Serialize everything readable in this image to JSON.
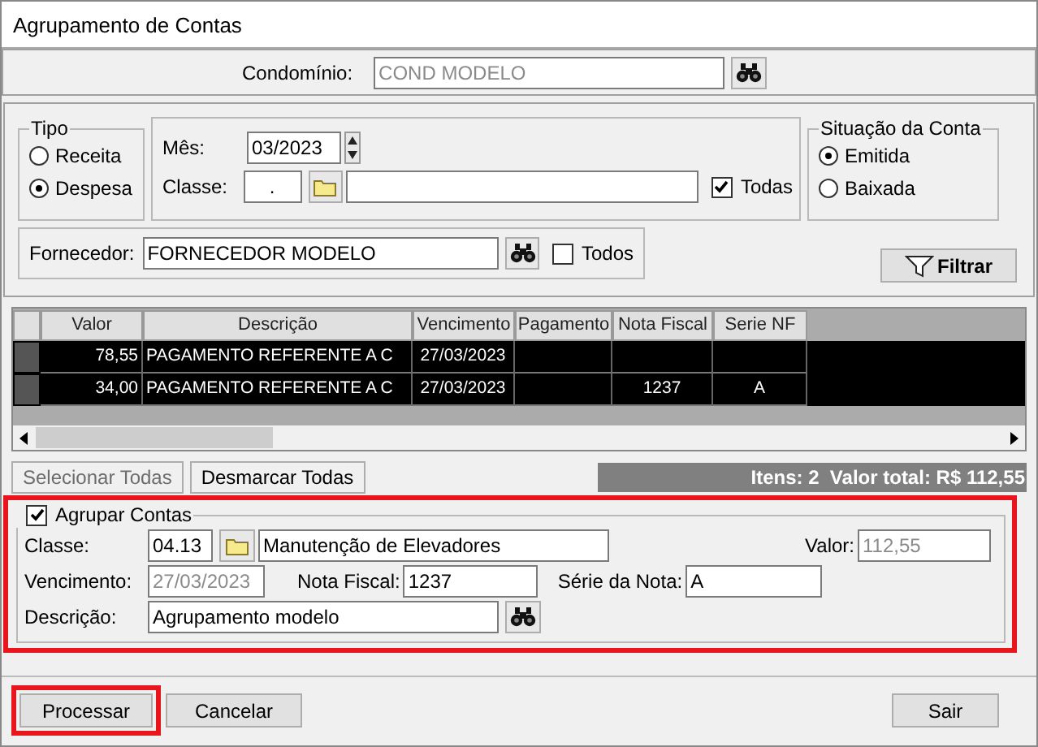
{
  "window": {
    "title": "Agrupamento de Contas"
  },
  "condominio": {
    "label": "Condomínio:",
    "value": "COND MODELO",
    "disabled": true
  },
  "tipo": {
    "title": "Tipo",
    "options": [
      {
        "label": "Receita",
        "selected": false
      },
      {
        "label": "Despesa",
        "selected": true
      }
    ]
  },
  "mes": {
    "label": "Mês:",
    "value": "03/2023"
  },
  "classe_filter": {
    "label": "Classe:",
    "code": ".",
    "todas": {
      "label": "Todas",
      "checked": true
    }
  },
  "situacao": {
    "title": "Situação da Conta",
    "options": [
      {
        "label": "Emitida",
        "selected": true
      },
      {
        "label": "Baixada",
        "selected": false
      }
    ]
  },
  "fornecedor": {
    "label": "Fornecedor:",
    "value": "FORNECEDOR MODELO",
    "todos": {
      "label": "Todos",
      "checked": false
    }
  },
  "filter_button": {
    "label": "Filtrar"
  },
  "table": {
    "columns": [
      "Valor",
      "Descrição",
      "Vencimento",
      "Pagamento",
      "Nota Fiscal",
      "Serie NF"
    ],
    "rows": [
      {
        "selected": true,
        "cells": [
          "78,55",
          "PAGAMENTO REFERENTE A C",
          "27/03/2023",
          null,
          null,
          null
        ]
      },
      {
        "selected": true,
        "cells": [
          "34,00",
          "PAGAMENTO REFERENTE A C",
          "27/03/2023",
          null,
          "1237",
          "A"
        ]
      }
    ]
  },
  "select_buttons": [
    {
      "label": "Selecionar Todas",
      "disabled": true
    },
    {
      "label": "Desmarcar Todas",
      "disabled": false
    }
  ],
  "summary": "Itens: 2  Valor total: R$ 112,55",
  "agrupar": {
    "label": "Agrupar Contas",
    "checked": true,
    "highlighted": true,
    "classe": {
      "label": "Classe:",
      "code": "04.13",
      "name": "Manutenção de Elevadores"
    },
    "valor": {
      "label": "Valor:",
      "value": "112,55",
      "disabled": true
    },
    "vencimento": {
      "label": "Vencimento:",
      "value": "27/03/2023",
      "disabled": true
    },
    "nota_fiscal": {
      "label": "Nota Fiscal:",
      "value": "1237"
    },
    "serie": {
      "label": "Série da Nota:",
      "value": "A"
    },
    "descricao": {
      "label": "Descrição:",
      "value": "Agrupamento modelo"
    }
  },
  "footer_buttons": [
    {
      "label": "Processar",
      "highlighted": true
    },
    {
      "label": "Cancelar",
      "highlighted": false
    },
    {
      "label": "Sair",
      "highlighted": false
    }
  ]
}
